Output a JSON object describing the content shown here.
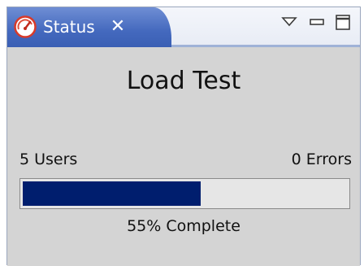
{
  "tab": {
    "title": "Status",
    "close_glyph": "✕",
    "icon": "gauge-icon"
  },
  "window_controls": {
    "view_menu_icon": "triangle-down-icon",
    "minimize_icon": "minimize-icon",
    "maximize_icon": "maximize-icon"
  },
  "main": {
    "title": "Load Test",
    "users_label": "5 Users",
    "errors_label": "0 Errors",
    "progress_fraction": 0.55,
    "progress_label": "55% Complete"
  },
  "colors": {
    "tab_blue": "#4469be",
    "progress_fill": "#001e6e",
    "panel_gray": "#d4d4d4"
  }
}
